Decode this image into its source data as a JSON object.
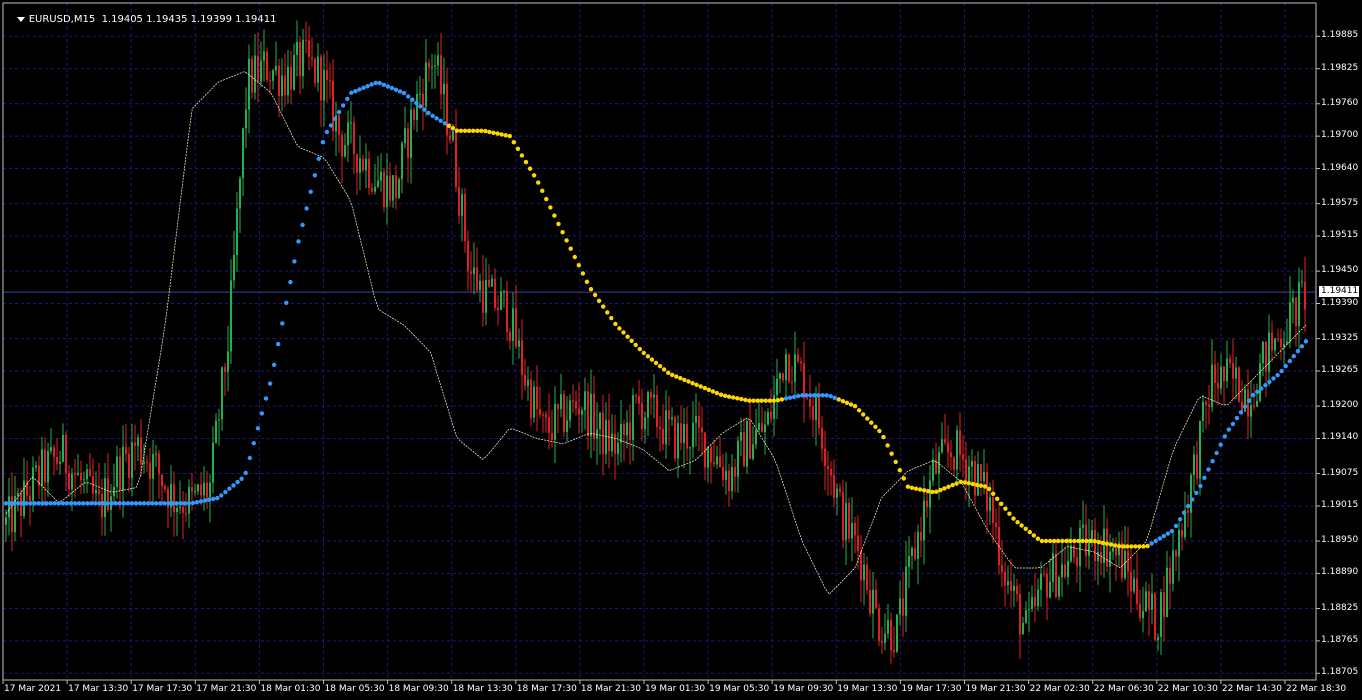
{
  "header": {
    "symbol": "EURUSD,M15",
    "ohlc": "1.19405 1.19435 1.19399 1.19411"
  },
  "current_price": "1.19411",
  "colors": {
    "background": "#000000",
    "grid": "#1a1a7a",
    "bull": "#22b14c",
    "bear": "#e02020",
    "ma_up": "#3399ff",
    "ma_down": "#ffd700",
    "fast_line": "#ffffcc",
    "bid_line": "#3344aa"
  },
  "chart_data": {
    "type": "line",
    "title": "EURUSD,M15",
    "ylim": [
      1.187,
      1.1993
    ],
    "y_ticks": [
      "1.19885",
      "1.19825",
      "1.19760",
      "1.19700",
      "1.19640",
      "1.19575",
      "1.19515",
      "1.19450",
      "1.19390",
      "1.19325",
      "1.19265",
      "1.19200",
      "1.19140",
      "1.19075",
      "1.19015",
      "1.18950",
      "1.18890",
      "1.18825",
      "1.18765",
      "1.18705"
    ],
    "x_ticks": [
      "17 Mar 2021",
      "17 Mar 13:30",
      "17 Mar 17:30",
      "17 Mar 21:30",
      "18 Mar 01:30",
      "18 Mar 05:30",
      "18 Mar 09:30",
      "18 Mar 13:30",
      "18 Mar 17:30",
      "18 Mar 21:30",
      "19 Mar 01:30",
      "19 Mar 05:30",
      "19 Mar 09:30",
      "19 Mar 13:30",
      "19 Mar 17:30",
      "19 Mar 21:30",
      "22 Mar 02:30",
      "22 Mar 06:30",
      "22 Mar 10:30",
      "22 Mar 14:30",
      "22 Mar 18:30"
    ],
    "price_path": [
      1.1898,
      1.1903,
      1.1908,
      1.1911,
      1.1906,
      1.1901,
      1.1908,
      1.1913,
      1.1909,
      1.1903,
      1.1902,
      1.1905,
      1.1933,
      1.198,
      1.1983,
      1.1981,
      1.1984,
      1.1981,
      1.197,
      1.1967,
      1.1962,
      1.196,
      1.1975,
      1.1985,
      1.197,
      1.1945,
      1.194,
      1.1938,
      1.1925,
      1.1915,
      1.1918,
      1.1921,
      1.1915,
      1.1912,
      1.192,
      1.1918,
      1.1914,
      1.1915,
      1.1912,
      1.1907,
      1.1914,
      1.1916,
      1.193,
      1.1925,
      1.1915,
      1.19,
      1.1893,
      1.188,
      1.1878,
      1.1894,
      1.1908,
      1.1912,
      1.1909,
      1.1902,
      1.1887,
      1.1878,
      1.1888,
      1.189,
      1.1894,
      1.1895,
      1.1892,
      1.1885,
      1.188,
      1.1893,
      1.1908,
      1.1925,
      1.1925,
      1.1922,
      1.193,
      1.1935,
      1.1941
    ],
    "ma_path": [
      1.1902,
      1.1902,
      1.1902,
      1.1902,
      1.1902,
      1.1902,
      1.1902,
      1.1902,
      1.1903,
      1.1907,
      1.1925,
      1.195,
      1.197,
      1.1978,
      1.198,
      1.1978,
      1.1974,
      1.1971,
      1.1971,
      1.197,
      1.1962,
      1.1952,
      1.1942,
      1.1935,
      1.193,
      1.1926,
      1.1924,
      1.1922,
      1.1921,
      1.1921,
      1.1922,
      1.1922,
      1.192,
      1.1915,
      1.1905,
      1.1904,
      1.1906,
      1.1905,
      1.1899,
      1.1895,
      1.1895,
      1.1895,
      1.1894,
      1.1894,
      1.1897,
      1.1905,
      1.1915,
      1.1922,
      1.1926,
      1.1932
    ],
    "ma_trend": [
      "up",
      "up",
      "up",
      "up",
      "up",
      "up",
      "up",
      "up",
      "up",
      "up",
      "up",
      "up",
      "up",
      "up",
      "up",
      "up",
      "up",
      "down",
      "down",
      "down",
      "down",
      "down",
      "down",
      "down",
      "down",
      "down",
      "down",
      "down",
      "down",
      "down",
      "up",
      "up",
      "down",
      "down",
      "down",
      "down",
      "down",
      "down",
      "down",
      "down",
      "down",
      "down",
      "down",
      "down",
      "up",
      "up",
      "up",
      "up",
      "up",
      "up"
    ],
    "fast_path": [
      1.19,
      1.1907,
      1.1902,
      1.1906,
      1.1904,
      1.1905,
      1.1935,
      1.1975,
      1.198,
      1.1982,
      1.1978,
      1.1968,
      1.1966,
      1.1958,
      1.1938,
      1.1935,
      1.193,
      1.1914,
      1.191,
      1.1916,
      1.1914,
      1.1913,
      1.1915,
      1.1914,
      1.1912,
      1.1908,
      1.191,
      1.1915,
      1.1918,
      1.191,
      1.1895,
      1.1885,
      1.189,
      1.1903,
      1.1908,
      1.191,
      1.1906,
      1.1897,
      1.189,
      1.189,
      1.1894,
      1.1893,
      1.189,
      1.1895,
      1.1912,
      1.1922,
      1.192,
      1.1925,
      1.193,
      1.1935
    ]
  }
}
